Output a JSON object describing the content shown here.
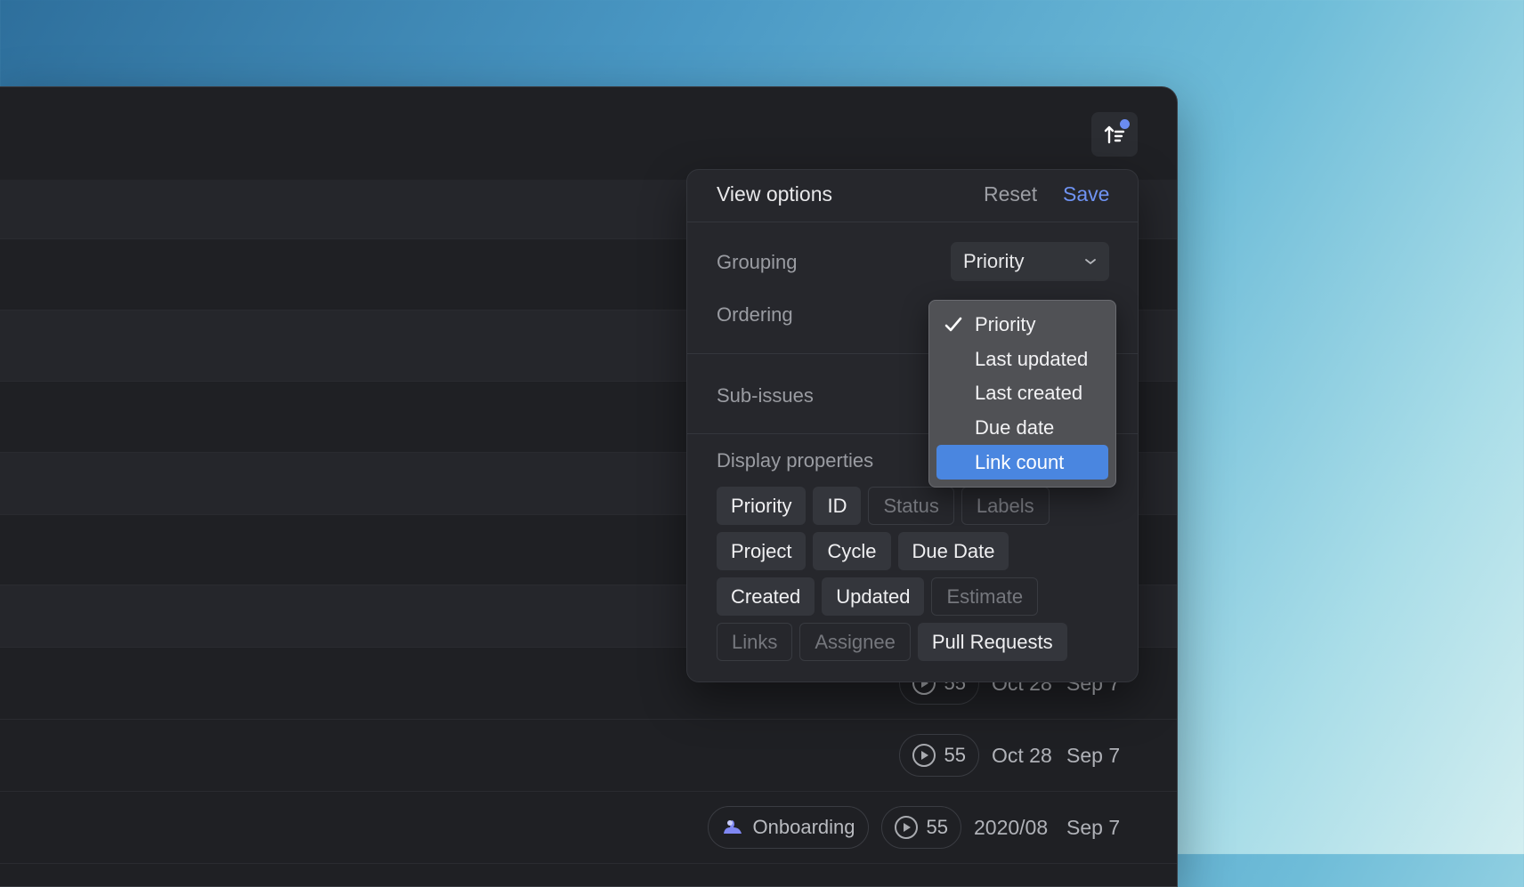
{
  "popover": {
    "title": "View options",
    "reset_label": "Reset",
    "save_label": "Save",
    "grouping": {
      "label": "Grouping",
      "value": "Priority"
    },
    "ordering": {
      "label": "Ordering"
    },
    "sub_issues": {
      "label": "Sub-issues"
    },
    "display_properties": {
      "label": "Display properties",
      "items": [
        {
          "label": "Priority",
          "enabled": true
        },
        {
          "label": "ID",
          "enabled": true
        },
        {
          "label": "Status",
          "enabled": false
        },
        {
          "label": "Labels",
          "enabled": false
        },
        {
          "label": "Project",
          "enabled": true
        },
        {
          "label": "Cycle",
          "enabled": true
        },
        {
          "label": "Due Date",
          "enabled": true
        },
        {
          "label": "Created",
          "enabled": true
        },
        {
          "label": "Updated",
          "enabled": true
        },
        {
          "label": "Estimate",
          "enabled": false
        },
        {
          "label": "Links",
          "enabled": false
        },
        {
          "label": "Assignee",
          "enabled": false
        },
        {
          "label": "Pull Requests",
          "enabled": true
        }
      ]
    }
  },
  "ordering_dropdown": {
    "options": [
      "Priority",
      "Last updated",
      "Last created",
      "Due date",
      "Link count"
    ],
    "selected": "Priority",
    "highlighted": "Link count"
  },
  "rows": [
    {
      "count": "55",
      "created": "Oct 28",
      "due": "Sep 7"
    },
    {
      "count": "55",
      "created": "Oct 28",
      "due": "Sep 7"
    },
    {
      "project": "Onboarding",
      "count": "55",
      "created": "2020/08",
      "due": "Sep 7"
    }
  ],
  "icons": {
    "sort_button": "sort-order-icon",
    "check": "checkmark-icon",
    "chevron": "chevron-down-icon",
    "cycle": "play-circle-icon",
    "project": "onboarding-project-icon"
  },
  "colors": {
    "accent": "#6f93f3",
    "highlight": "#4a86e0",
    "notification_dot": "#6b8cf0"
  }
}
